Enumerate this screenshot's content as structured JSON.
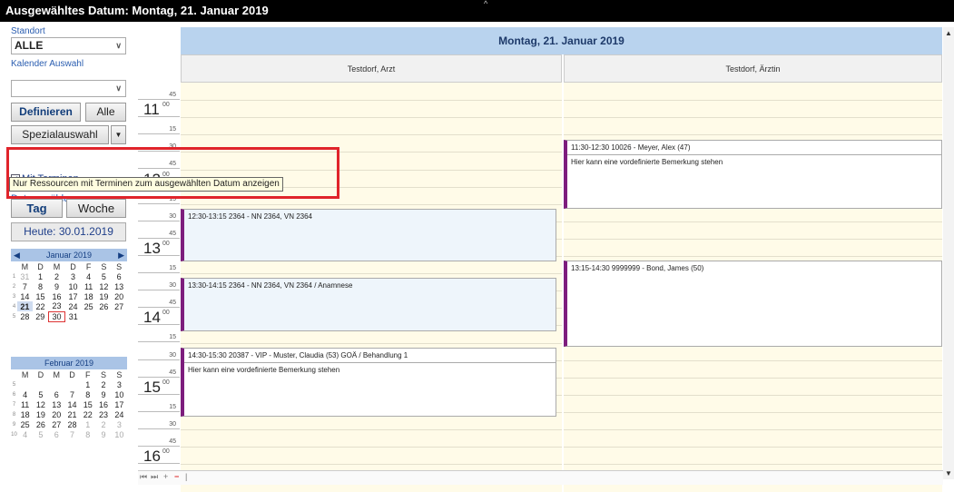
{
  "title_bar": {
    "text": "Ausgewähltes Datum:  Montag, 21. Januar 2019"
  },
  "sidebar": {
    "standort_label": "Standort",
    "standort_value": "ALLE",
    "kalender_label": "Kalender Auswahl",
    "kalender_value": "",
    "definieren_label": "Definieren",
    "alle_label": "Alle",
    "spezial_label": "Spezialauswahl",
    "mit_terminen_label": "Mit Terminen",
    "mit_terminen_checked": true,
    "datum_label": "Datum wählen",
    "tag_label": "Tag",
    "woche_label": "Woche",
    "heute_label": "Heute: 30.01.2019",
    "tooltip": "Nur Ressourcen mit Terminen zum ausgewählten Datum anzeigen"
  },
  "mini_calendar_jan": {
    "header": "Januar 2019",
    "weekdays": [
      "M",
      "D",
      "M",
      "D",
      "F",
      "S",
      "S"
    ],
    "weeks": [
      {
        "wk": "1",
        "days": [
          "31",
          "1",
          "2",
          "3",
          "4",
          "5",
          "6"
        ]
      },
      {
        "wk": "2",
        "days": [
          "7",
          "8",
          "9",
          "10",
          "11",
          "12",
          "13"
        ]
      },
      {
        "wk": "3",
        "days": [
          "14",
          "15",
          "16",
          "17",
          "18",
          "19",
          "20"
        ]
      },
      {
        "wk": "4",
        "days": [
          "21",
          "22",
          "23",
          "24",
          "25",
          "26",
          "27"
        ]
      },
      {
        "wk": "5",
        "days": [
          "28",
          "29",
          "30",
          "31",
          "",
          "",
          ""
        ]
      }
    ]
  },
  "mini_calendar_feb": {
    "header": "Februar 2019",
    "weekdays": [
      "M",
      "D",
      "M",
      "D",
      "F",
      "S",
      "S"
    ],
    "weeks": [
      {
        "wk": "5",
        "days": [
          "",
          "",
          "",
          "",
          "1",
          "2",
          "3"
        ]
      },
      {
        "wk": "6",
        "days": [
          "4",
          "5",
          "6",
          "7",
          "8",
          "9",
          "10"
        ]
      },
      {
        "wk": "7",
        "days": [
          "11",
          "12",
          "13",
          "14",
          "15",
          "16",
          "17"
        ]
      },
      {
        "wk": "8",
        "days": [
          "18",
          "19",
          "20",
          "21",
          "22",
          "23",
          "24"
        ]
      },
      {
        "wk": "9",
        "days": [
          "25",
          "26",
          "27",
          "28",
          "1",
          "2",
          "3"
        ]
      },
      {
        "wk": "10",
        "days": [
          "4",
          "5",
          "6",
          "7",
          "8",
          "9",
          "10"
        ]
      }
    ]
  },
  "time_slots": [
    {
      "m": "45"
    },
    {
      "h": "11",
      "m": "00"
    },
    {
      "m": "15"
    },
    {
      "m": "30"
    },
    {
      "m": "45"
    },
    {
      "h": "12",
      "m": "00"
    },
    {
      "m": "15"
    },
    {
      "m": "30"
    },
    {
      "m": "45"
    },
    {
      "h": "13",
      "m": "00"
    },
    {
      "m": "15"
    },
    {
      "m": "30"
    },
    {
      "m": "45"
    },
    {
      "h": "14",
      "m": "00"
    },
    {
      "m": "15"
    },
    {
      "m": "30"
    },
    {
      "m": "45"
    },
    {
      "h": "15",
      "m": "00"
    },
    {
      "m": "15"
    },
    {
      "m": "30"
    },
    {
      "m": "45"
    },
    {
      "h": "16",
      "m": "00"
    }
  ],
  "day_header": "Montag, 21. Januar 2019",
  "resources": [
    {
      "name": "Testdorf, Arzt"
    },
    {
      "name": "Testdorf, Ärztin"
    }
  ],
  "appointments": {
    "a1": {
      "line1": "12:30-13:15 2364 - NN 2364, VN 2364",
      "line2": ""
    },
    "a2": {
      "line1": "13:30-14:15 2364 - NN 2364, VN 2364 / Anamnese",
      "line2": ""
    },
    "a3": {
      "line1": "14:30-15:30 20387 - VIP - Muster, Claudia (53) GOÄ / Behandlung 1",
      "line2": "Hier kann eine vordefinierte Bemerkung stehen"
    },
    "b1": {
      "line1": "11:30-12:30 10026 - Meyer, Alex (47)",
      "line2": "Hier kann eine vordefinierte Bemerkung stehen"
    },
    "b2": {
      "line1": "13:15-14:30 9999999 - Bond, James (50)",
      "line2": ""
    }
  }
}
